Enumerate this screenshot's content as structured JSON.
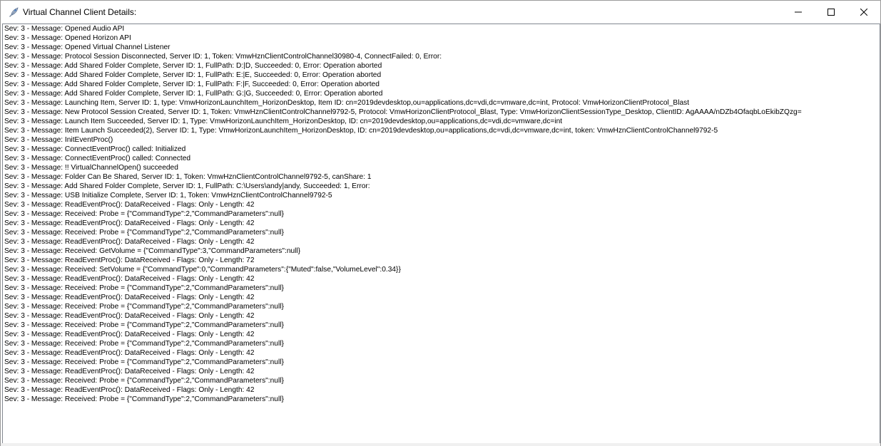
{
  "window": {
    "title": "Virtual Channel Client Details:",
    "icon": "rocket-feather-icon",
    "controls": {
      "minimize": "minimize-icon",
      "maximize": "maximize-icon",
      "close": "close-icon"
    },
    "accent_color": "#0078d7",
    "top_border_color": "#2b79c2"
  },
  "log": {
    "selected_index": 41,
    "lines": [
      "Sev: 3 - Message: Opened Audio API",
      "Sev: 3 - Message: Opened Horizon API",
      "Sev: 3 - Message: Opened Virtual Channel Listener",
      "Sev: 3 - Message: Protocol Session Disconnected, Server ID: 1, Token: VmwHznClientControlChannel30980-4, ConnectFailed: 0, Error:",
      "Sev: 3 - Message: Add Shared Folder Complete, Server ID: 1, FullPath: D:|D, Succeeded: 0, Error: Operation aborted",
      "Sev: 3 - Message: Add Shared Folder Complete, Server ID: 1, FullPath: E:|E, Succeeded: 0, Error: Operation aborted",
      "Sev: 3 - Message: Add Shared Folder Complete, Server ID: 1, FullPath: F:|F, Succeeded: 0, Error: Operation aborted",
      "Sev: 3 - Message: Add Shared Folder Complete, Server ID: 1, FullPath: G:|G, Succeeded: 0, Error: Operation aborted",
      "Sev: 3 - Message: Launching Item, Server ID: 1, type: VmwHorizonLaunchItem_HorizonDesktop, Item ID: cn=2019devdesktop,ou=applications,dc=vdi,dc=vmware,dc=int, Protocol: VmwHorizonClientProtocol_Blast",
      "Sev: 3 - Message: New Protocol Session Created, Server ID: 1, Token: VmwHznClientControlChannel9792-5, Protocol: VmwHorizonClientProtocol_Blast, Type: VmwHorizonClientSessionType_Desktop, ClientID: AgAAAA/nDZb4OfaqbLoEkibZQzg=",
      "Sev: 3 - Message: Launch Item Succeeded, Server ID: 1, Type: VmwHorizonLaunchItem_HorizonDesktop, ID: cn=2019devdesktop,ou=applications,dc=vdi,dc=vmware,dc=int",
      "Sev: 3 - Message: Item Launch Succeeded(2), Server ID: 1, Type: VmwHorizonLaunchItem_HorizonDesktop, ID: cn=2019devdesktop,ou=applications,dc=vdi,dc=vmware,dc=int, token: VmwHznClientControlChannel9792-5",
      "Sev: 3 - Message: InitEventProc()",
      "Sev: 3 - Message: ConnectEventProc() called: Initialized",
      "Sev: 3 - Message: ConnectEventProc() called: Connected",
      "Sev: 3 - Message: !! VirtualChannelOpen() succeeded",
      "Sev: 3 - Message: Folder Can Be Shared, Server ID: 1, Token: VmwHznClientControlChannel9792-5, canShare: 1",
      "Sev: 3 - Message: Add Shared Folder Complete, Server ID: 1, FullPath: C:\\Users\\andy|andy, Succeeded: 1, Error:",
      "Sev: 3 - Message: USB Initialize Complete, Server ID: 1, Token: VmwHznClientControlChannel9792-5",
      "Sev: 3 - Message: ReadEventProc(): DataReceived - Flags: Only - Length: 42",
      "Sev: 3 - Message: Received: Probe = {\"CommandType\":2,\"CommandParameters\":null}",
      "Sev: 3 - Message: ReadEventProc(): DataReceived - Flags: Only - Length: 42",
      "Sev: 3 - Message: Received: Probe = {\"CommandType\":2,\"CommandParameters\":null}",
      "Sev: 3 - Message: ReadEventProc(): DataReceived - Flags: Only - Length: 42",
      "Sev: 3 - Message: Received: GetVolume = {\"CommandType\":3,\"CommandParameters\":null}",
      "Sev: 3 - Message: ReadEventProc(): DataReceived - Flags: Only - Length: 72",
      "Sev: 3 - Message: Received: SetVolume = {\"CommandType\":0,\"CommandParameters\":{\"Muted\":false,\"VolumeLevel\":0.34}}",
      "Sev: 3 - Message: ReadEventProc(): DataReceived - Flags: Only - Length: 42",
      "Sev: 3 - Message: Received: Probe = {\"CommandType\":2,\"CommandParameters\":null}",
      "Sev: 3 - Message: ReadEventProc(): DataReceived - Flags: Only - Length: 42",
      "Sev: 3 - Message: Received: Probe = {\"CommandType\":2,\"CommandParameters\":null}",
      "Sev: 3 - Message: ReadEventProc(): DataReceived - Flags: Only - Length: 42",
      "Sev: 3 - Message: Received: Probe = {\"CommandType\":2,\"CommandParameters\":null}",
      "Sev: 3 - Message: ReadEventProc(): DataReceived - Flags: Only - Length: 42",
      "Sev: 3 - Message: Received: Probe = {\"CommandType\":2,\"CommandParameters\":null}",
      "Sev: 3 - Message: ReadEventProc(): DataReceived - Flags: Only - Length: 42",
      "Sev: 3 - Message: Received: Probe = {\"CommandType\":2,\"CommandParameters\":null}",
      "Sev: 3 - Message: ReadEventProc(): DataReceived - Flags: Only - Length: 42",
      "Sev: 3 - Message: Received: Probe = {\"CommandType\":2,\"CommandParameters\":null}",
      "Sev: 3 - Message: ReadEventProc(): DataReceived - Flags: Only - Length: 42",
      "Sev: 3 - Message: Received: Probe = {\"CommandType\":2,\"CommandParameters\":null}"
    ]
  }
}
